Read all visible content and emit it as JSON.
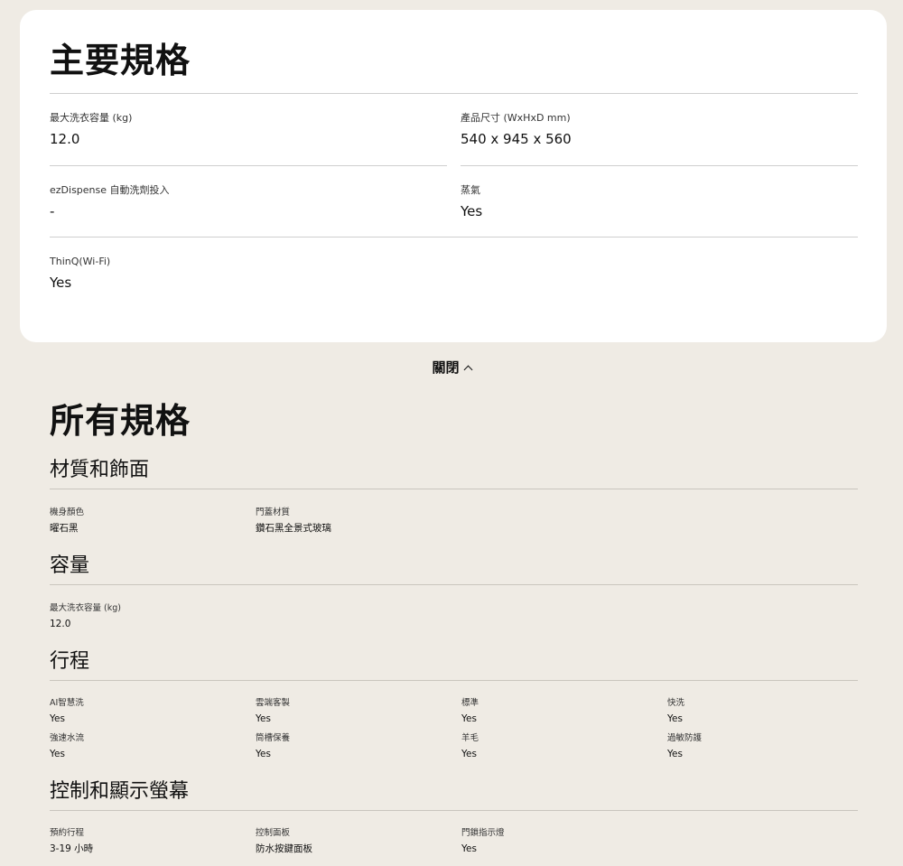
{
  "key_specs": {
    "title": "主要規格",
    "items": [
      {
        "label": "最大洗衣容量 (kg)",
        "value": "12.0"
      },
      {
        "label": "產品尺寸 (WxHxD mm)",
        "value": "540 x 945 x 560"
      },
      {
        "label": "ezDispense 自動洗劑投入",
        "value": "-"
      },
      {
        "label": "蒸氣",
        "value": "Yes"
      },
      {
        "label": "ThinQ(Wi-Fi)",
        "value": "Yes"
      }
    ]
  },
  "close_label": "關閉",
  "all_specs": {
    "title": "所有規格",
    "sections": [
      {
        "title": "材質和飾面",
        "items": [
          {
            "label": "機身顏色",
            "value": "曜石黑"
          },
          {
            "label": "門蓋材質",
            "value": "鑽石黑全景式玻璃"
          }
        ]
      },
      {
        "title": "容量",
        "items": [
          {
            "label": "最大洗衣容量 (kg)",
            "value": "12.0"
          }
        ]
      },
      {
        "title": "行程",
        "items": [
          {
            "label": "AI智慧洗",
            "value": "Yes"
          },
          {
            "label": "雲端客製",
            "value": "Yes"
          },
          {
            "label": "標準",
            "value": "Yes"
          },
          {
            "label": "快洗",
            "value": "Yes"
          },
          {
            "label": "強速水流",
            "value": "Yes"
          },
          {
            "label": "筒槽保養",
            "value": "Yes"
          },
          {
            "label": "羊毛",
            "value": "Yes"
          },
          {
            "label": "過敏防護",
            "value": "Yes"
          }
        ]
      },
      {
        "title": "控制和顯示螢幕",
        "items": [
          {
            "label": "預約行程",
            "value": "3-19 小時"
          },
          {
            "label": "控制面板",
            "value": "防水按鍵面板"
          },
          {
            "label": "門鎖指示燈",
            "value": "Yes"
          }
        ]
      }
    ]
  }
}
